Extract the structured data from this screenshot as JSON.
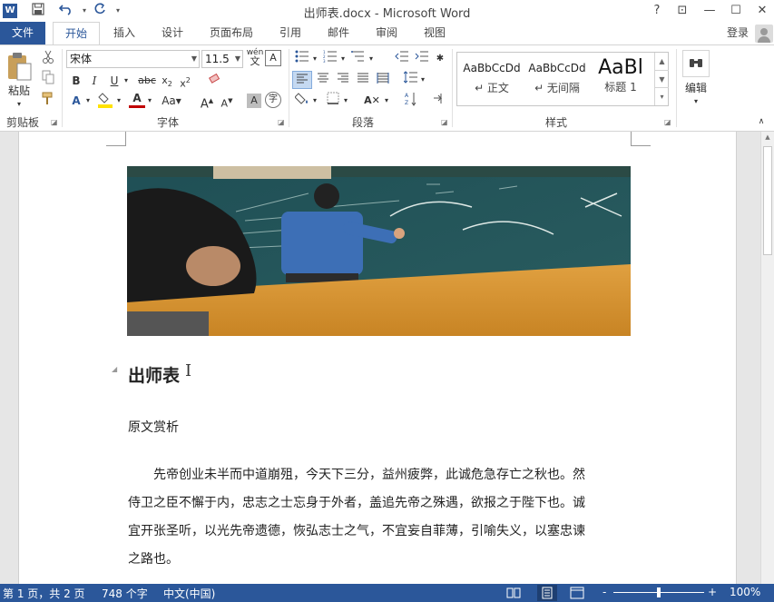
{
  "window": {
    "title": "出师表.docx - Microsoft Word",
    "help": "?",
    "restore_ribbon": "⊡",
    "minimize": "—",
    "maximize": "☐",
    "close": "✕"
  },
  "qat": {
    "word_icon": "W",
    "save_icon": "save-icon",
    "undo_icon": "undo-icon",
    "redo_icon": "redo-icon",
    "more": "▾"
  },
  "tabs": {
    "file": "文件",
    "items": [
      "开始",
      "插入",
      "设计",
      "页面布局",
      "引用",
      "邮件",
      "审阅",
      "视图"
    ],
    "active": "开始",
    "login": "登录"
  },
  "ribbon": {
    "clipboard": {
      "paste": "粘贴",
      "label": "剪贴板"
    },
    "font": {
      "name": "宋体",
      "size": "11.5",
      "wen": "wén",
      "label": "字体"
    },
    "paragraph": {
      "label": "段落"
    },
    "styles": {
      "label": "样式",
      "items": [
        {
          "sample": "AaBbCcDd",
          "name": "↵ 正文"
        },
        {
          "sample": "AaBbCcDd",
          "name": "↵ 无间隔"
        },
        {
          "sample": "AaBl",
          "name": "标题 1"
        }
      ]
    },
    "editing": {
      "label": "编辑"
    }
  },
  "document": {
    "heading": "出师表",
    "subheading": "原文赏析",
    "paragraph_lines": [
      "　　先帝创业未半而中道崩殂，今天下三分，益州疲弊，此诚危急存亡之秋也。然",
      "侍卫之臣不懈于内，忠志之士忘身于外者，盖追先帝之殊遇，欲报之于陛下也。诚",
      "宜开张圣听，以光先帝遗德，恢弘志士之气，不宜妄自菲薄，引喻失义，以塞忠谏",
      "之路也。"
    ]
  },
  "status": {
    "page": "第 1 页，共 2 页",
    "words": "748 个字",
    "language": "中文(中国)",
    "zoom": "100%",
    "zoom_minus": "-",
    "zoom_plus": "+"
  },
  "colors": {
    "accent": "#2b579a",
    "highlight": "#ffe200",
    "font_color": "#c00000"
  }
}
